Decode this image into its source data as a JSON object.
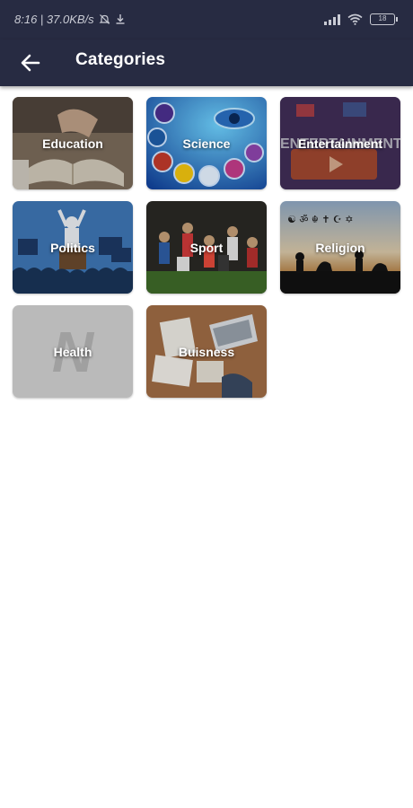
{
  "status_bar": {
    "time_speed": "8:16 | 37.0KB/s",
    "battery": "18"
  },
  "app_bar": {
    "title": "Categories",
    "back_icon": "arrow-left-icon"
  },
  "categories": [
    {
      "label": "Education"
    },
    {
      "label": "Science"
    },
    {
      "label": "Entertainment"
    },
    {
      "label": "Politics"
    },
    {
      "label": "Sport"
    },
    {
      "label": "Religion"
    },
    {
      "label": "Health",
      "logo_letter": "N"
    },
    {
      "label": "Buisness"
    }
  ],
  "colors": {
    "app_bar": "#272b42",
    "background": "#ffffff",
    "card_label": "#ffffff"
  }
}
